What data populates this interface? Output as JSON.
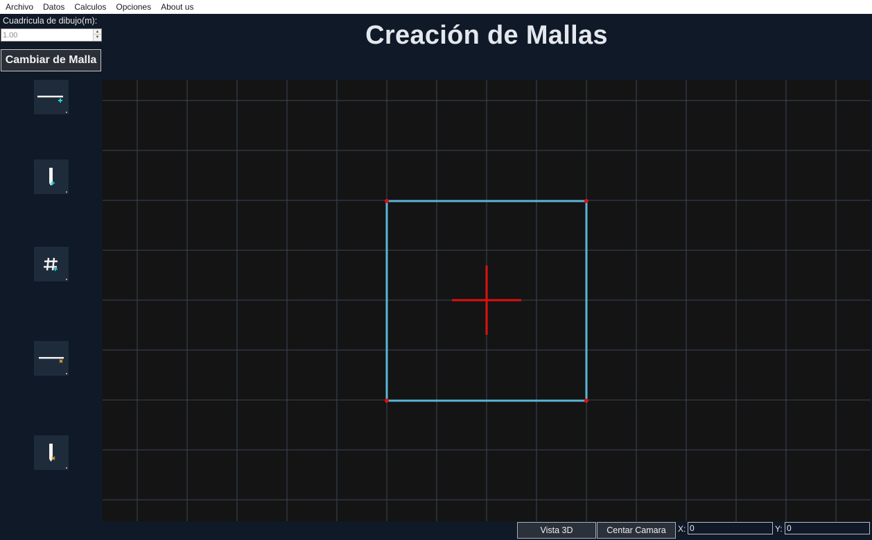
{
  "menu": {
    "items": [
      "Archivo",
      "Datos",
      "Calculos",
      "Opciones",
      "About us"
    ]
  },
  "left_panel": {
    "grid_label": "Cuadricula de dibujo(m):",
    "grid_value": "1.00",
    "change_mesh_label": "Cambiar de Malla",
    "tools": [
      {
        "icon": "add-horizontal-line-icon"
      },
      {
        "icon": "add-vertical-line-icon"
      },
      {
        "icon": "add-grid-icon"
      },
      {
        "icon": "remove-horizontal-line-icon"
      },
      {
        "icon": "remove-vertical-line-icon"
      }
    ]
  },
  "header": {
    "title": "Creación de Mallas"
  },
  "bottom_bar": {
    "view3d_label": "Vista 3D",
    "center_camera_label": "Centar Camara",
    "x_label": "X:",
    "x_value": "0",
    "y_label": "Y:",
    "y_value": "0"
  },
  "colors": {
    "background": "#0f1927",
    "canvas": "#141414",
    "grid_line": "#3b4656",
    "mesh_edge": "#5bb6d8",
    "node": "#e01010",
    "origin_cross": "#e01010",
    "tool_add_accent": "#2ad1d1",
    "tool_remove_accent": "#e89a2a"
  }
}
